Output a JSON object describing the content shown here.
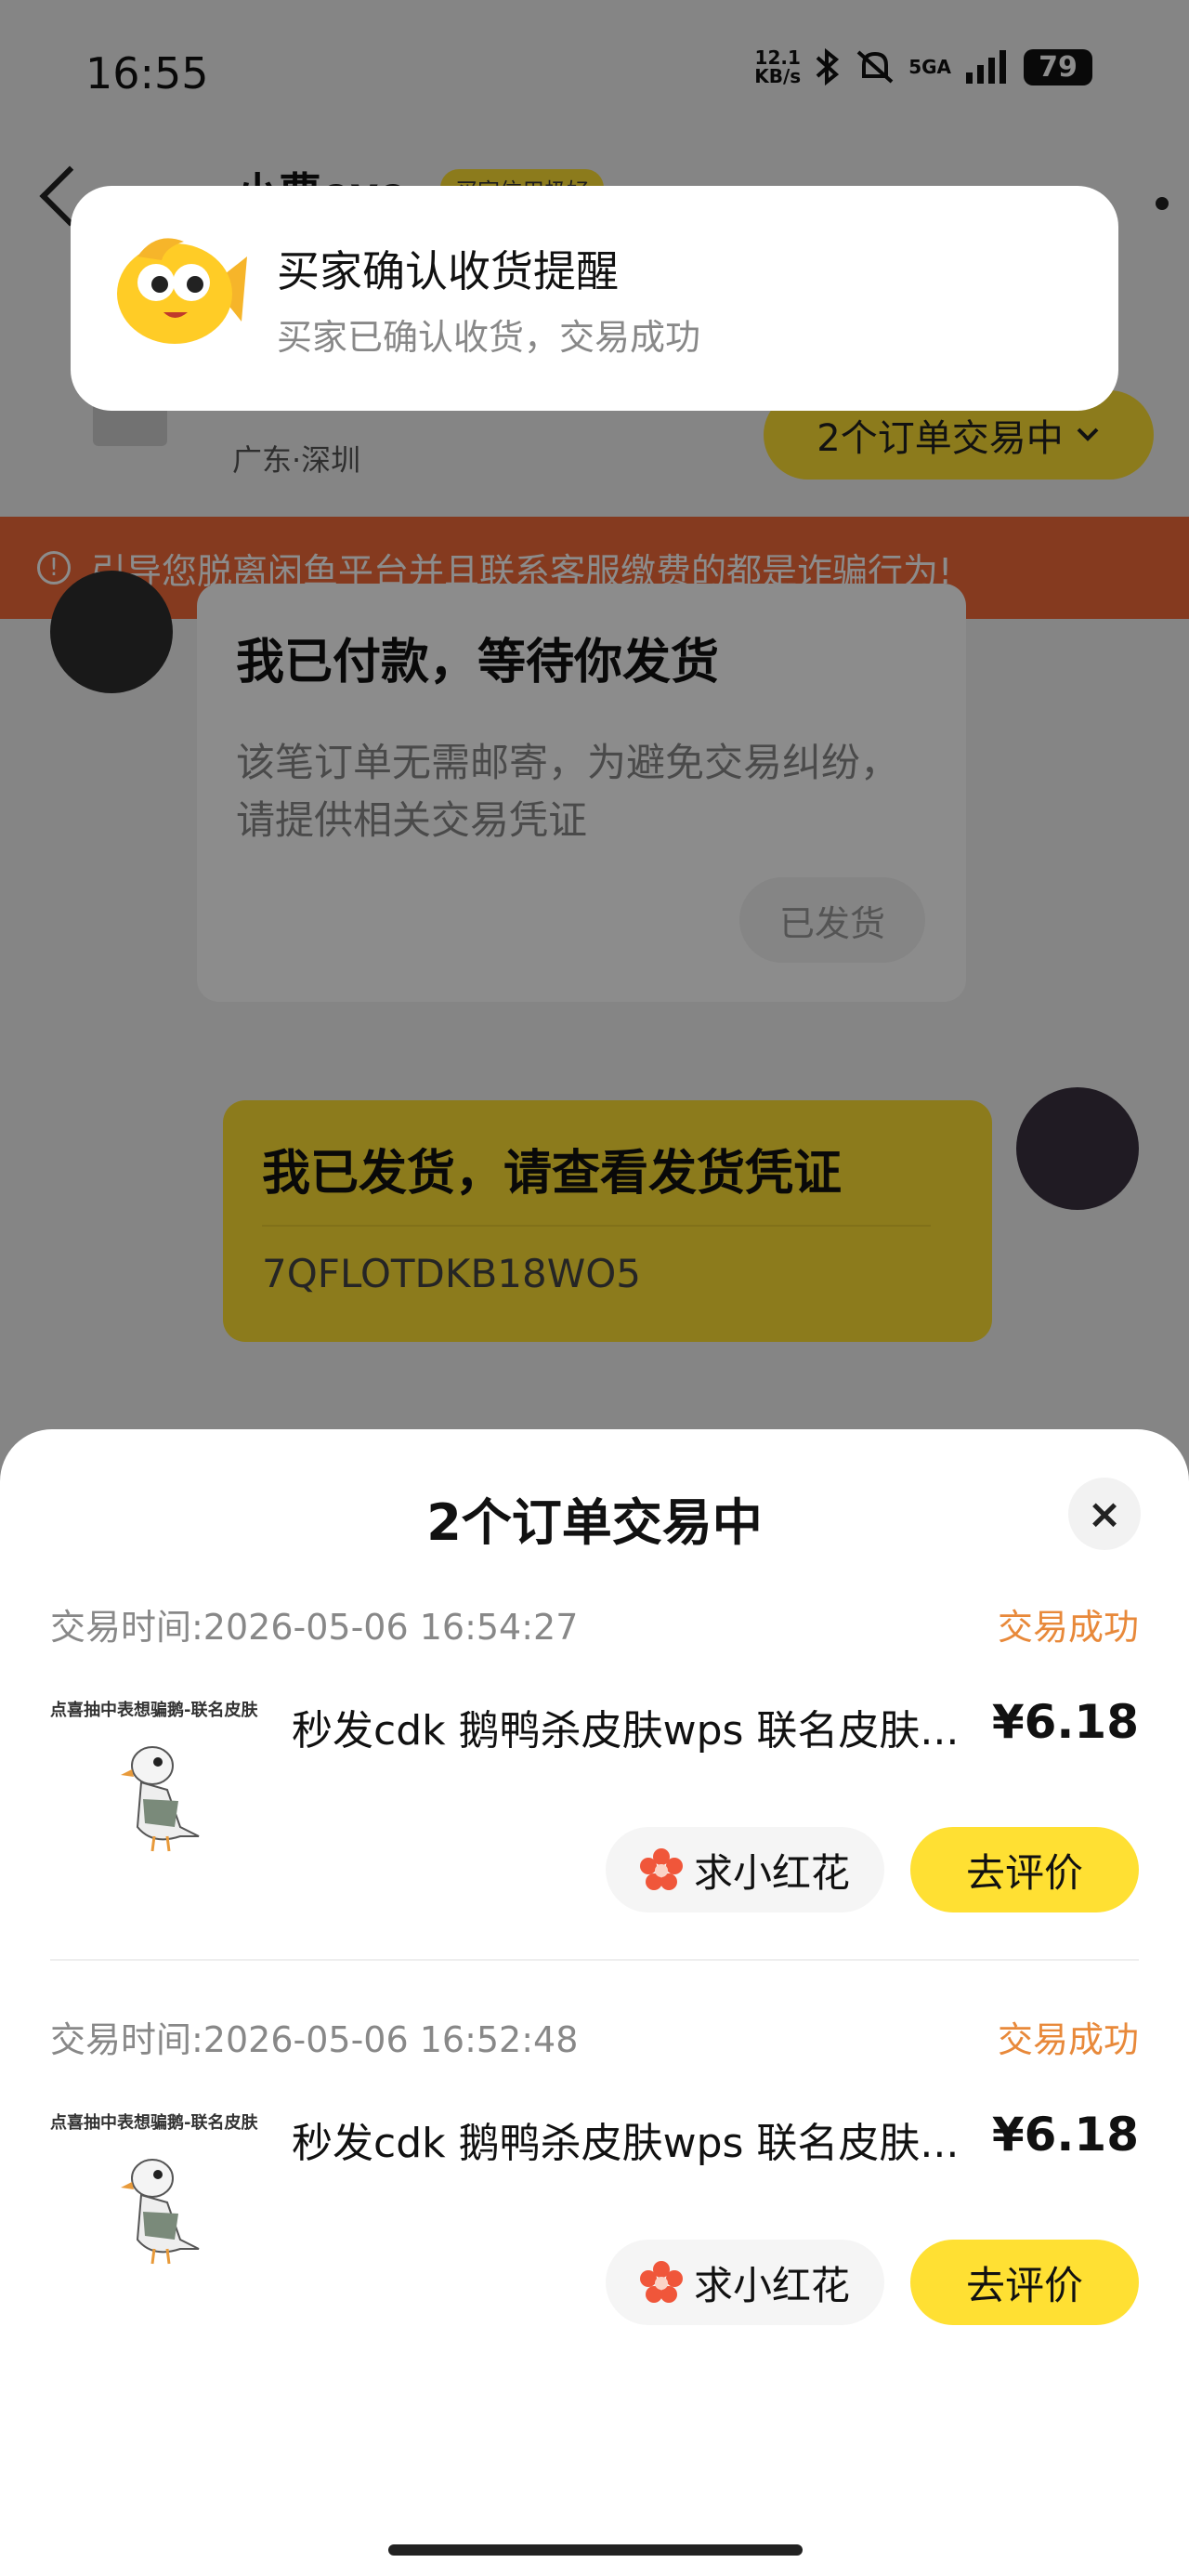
{
  "status_bar": {
    "time": "16:55",
    "net_speed_value": "12.1",
    "net_speed_unit": "KB/s",
    "network": "5GA",
    "battery": "79",
    "icons": [
      "bluetooth-icon",
      "mute-icon",
      "signal-icon"
    ]
  },
  "header": {
    "peer_name": "小曹eve",
    "peer_tag": "买家信用极好",
    "location": "广东·深圳",
    "orders_pill": "2个订单交易中"
  },
  "warning": {
    "text": "引导您脱离闲鱼平台并且联系客服缴费的都是诈骗行为!"
  },
  "chat": {
    "left_bubble": {
      "title": "我已付款，等待你发货",
      "body": "该笔订单无需邮寄，为避免交易纠纷，请提供相关交易凭证",
      "button": "已发货"
    },
    "right_bubble": {
      "title": "我已发货，请查看发货凭证",
      "code": "7QFLOTDKB18WO5"
    }
  },
  "notification": {
    "title": "买家确认收货提醒",
    "subtitle": "买家已确认收货，交易成功"
  },
  "sheet": {
    "title": "2个订单交易中",
    "close": "×",
    "orders": [
      {
        "time": "交易时间:2026-05-06 16:54:27",
        "status": "交易成功",
        "thumb_caption": "点喜抽中表想骗鹅-联名皮肤",
        "name": "秒发cdk 鹅鸭杀皮肤wps 联名皮肤...",
        "price": "¥6.18",
        "flower_label": "求小红花",
        "review_label": "去评价"
      },
      {
        "time": "交易时间:2026-05-06 16:52:48",
        "status": "交易成功",
        "thumb_caption": "点喜抽中表想骗鹅-联名皮肤",
        "name": "秒发cdk 鹅鸭杀皮肤wps 联名皮肤...",
        "price": "¥6.18",
        "flower_label": "求小红花",
        "review_label": "去评价"
      }
    ]
  },
  "colors": {
    "accent_yellow": "#ffe033",
    "warning_orange": "#f26b3a",
    "status_orange": "#e8893a"
  }
}
